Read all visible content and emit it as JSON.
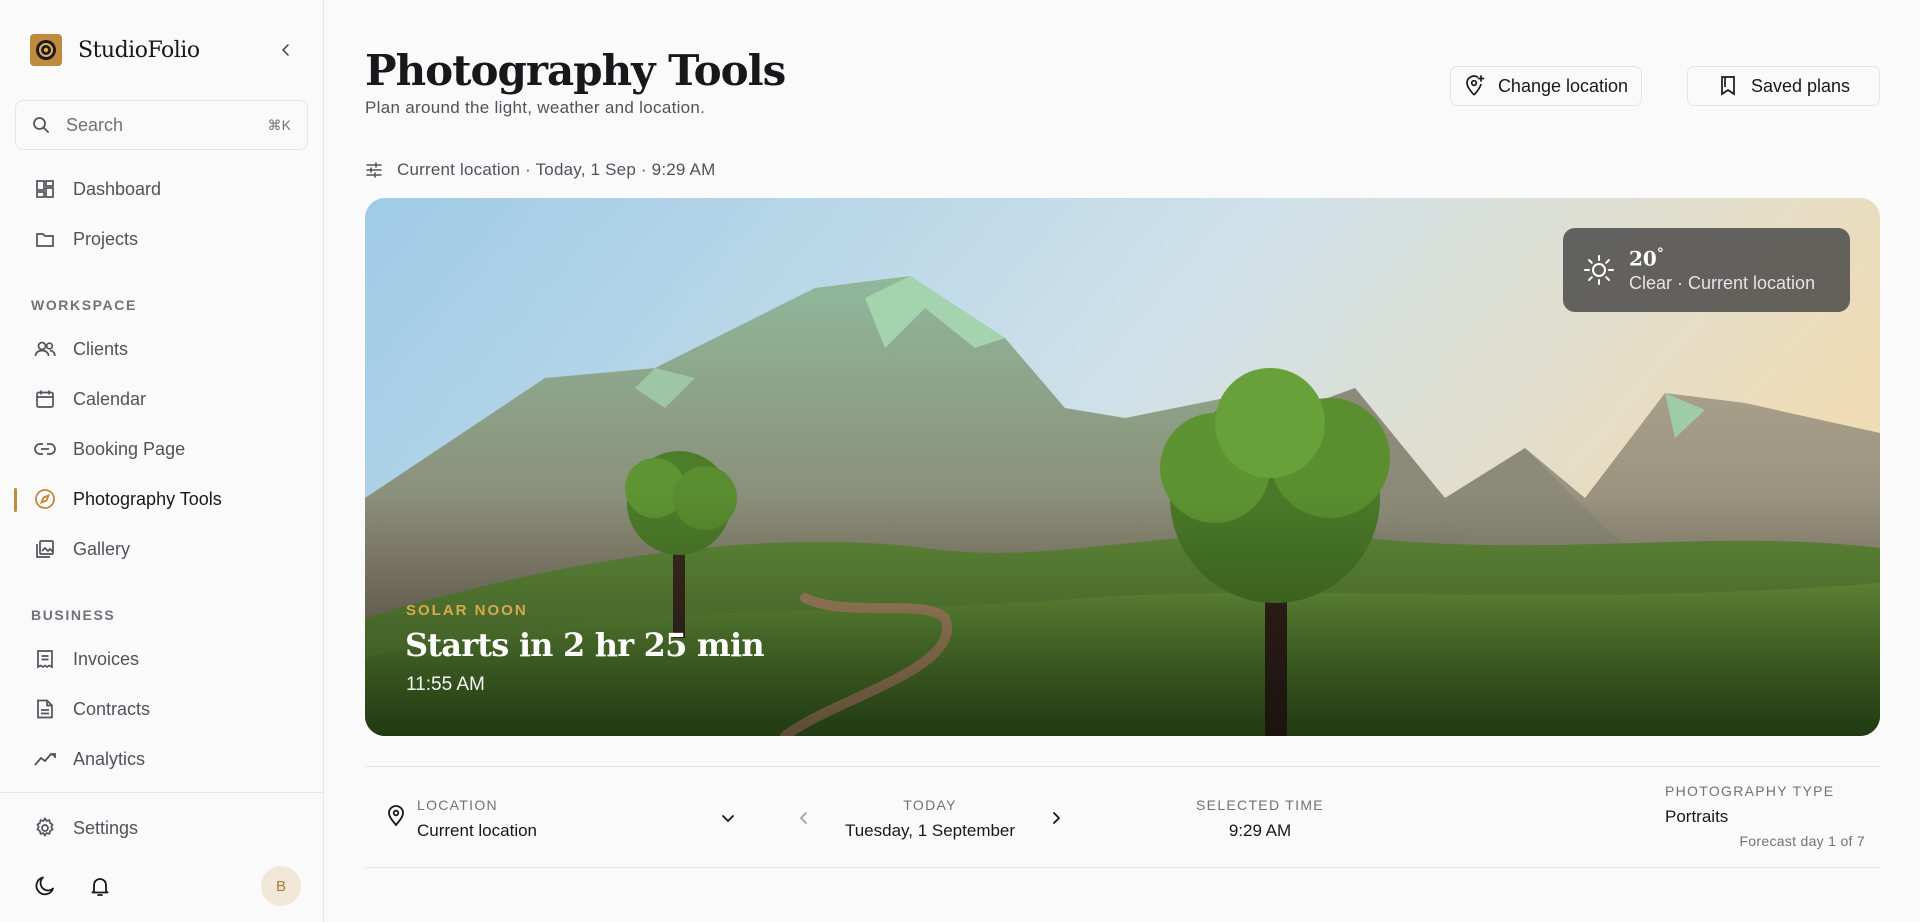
{
  "sidebar": {
    "brand": "StudioFolio",
    "search_placeholder": "Search",
    "search_shortcut": "⌘K",
    "sections": {
      "workspace": "WORKSPACE",
      "business": "BUSINESS"
    },
    "items": {
      "dashboard": "Dashboard",
      "projects": "Projects",
      "clients": "Clients",
      "calendar": "Calendar",
      "booking": "Booking Page",
      "photo_tools": "Photography Tools",
      "gallery": "Gallery",
      "invoices": "Invoices",
      "contracts": "Contracts",
      "analytics": "Analytics",
      "settings": "Settings"
    },
    "avatar_initial": "B",
    "accent": "#c08a3e"
  },
  "header": {
    "title": "Photography Tools",
    "subtitle": "Plan around the light, weather and location.",
    "change_location": "Change location",
    "saved_plans": "Saved plans"
  },
  "context": {
    "text": "Current location · Today, 1 Sep · 9:29 AM"
  },
  "hero": {
    "weather_temp": "20",
    "weather_degree": "°",
    "weather_desc": "Clear · Current location",
    "kicker": "SOLAR NOON",
    "title": "Starts in 2 hr 25 min",
    "time": "11:55 AM"
  },
  "controls": {
    "location_label": "LOCATION",
    "location_value": "Current location",
    "date_label": "TODAY",
    "date_value": "Tuesday, 1 September",
    "time_label": "SELECTED TIME",
    "time_value": "9:29 AM",
    "type_label": "PHOTOGRAPHY TYPE",
    "type_value": "Portraits",
    "forecast_note": "Forecast day 1 of 7"
  }
}
